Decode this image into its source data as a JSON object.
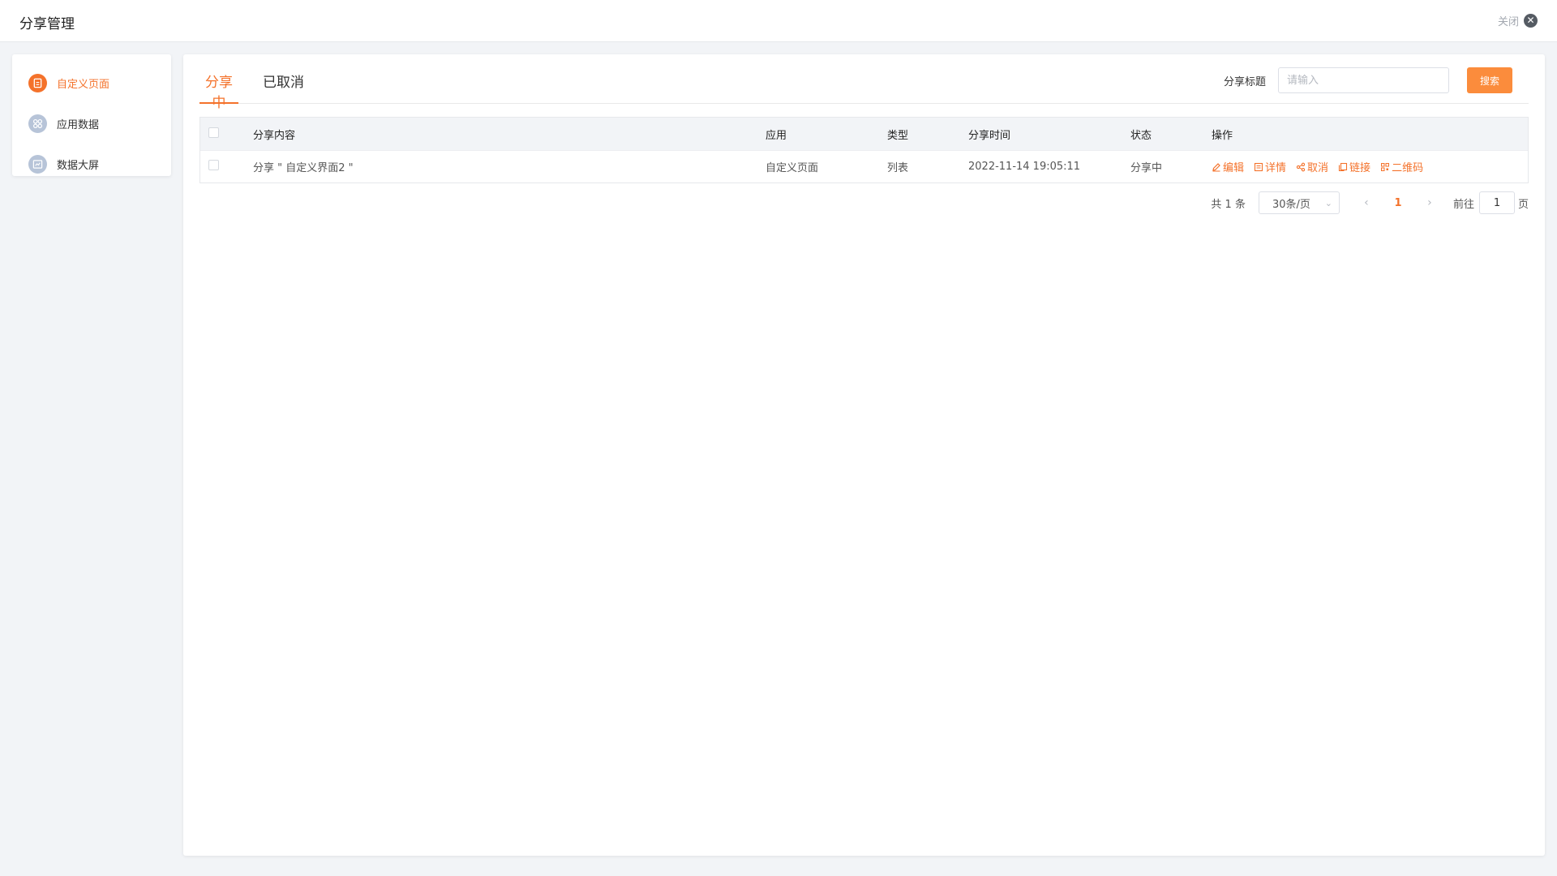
{
  "header": {
    "title": "分享管理",
    "close_label": "关闭"
  },
  "sidebar": {
    "items": [
      {
        "label": "自定义页面",
        "icon": "document-icon",
        "active": true
      },
      {
        "label": "应用数据",
        "icon": "apps-grid-icon",
        "active": false
      },
      {
        "label": "数据大屏",
        "icon": "dashboard-screen-icon",
        "active": false
      }
    ]
  },
  "tabs": [
    {
      "label": "分享中",
      "active": true
    },
    {
      "label": "已取消",
      "active": false
    }
  ],
  "search": {
    "label": "分享标题",
    "placeholder": "请输入",
    "button": "搜索"
  },
  "table": {
    "columns": [
      "分享内容",
      "应用",
      "类型",
      "分享时间",
      "状态",
      "操作"
    ],
    "rows": [
      {
        "content": "分享 \" 自定义界面2 \"",
        "app": "自定义页面",
        "type": "列表",
        "time": "2022-11-14 19:05:11",
        "status": "分享中",
        "ops": [
          "编辑",
          "详情",
          "取消",
          "链接",
          "二维码"
        ]
      }
    ]
  },
  "pagination": {
    "total": "共 1 条",
    "page_size": "30条/页",
    "current_page": "1",
    "goto_label": "前往",
    "goto_value": "1",
    "goto_suffix": "页"
  },
  "colors": {
    "accent": "#f4722b",
    "button": "#fb8c3c",
    "inactive_icon": "#b7c4d8"
  }
}
